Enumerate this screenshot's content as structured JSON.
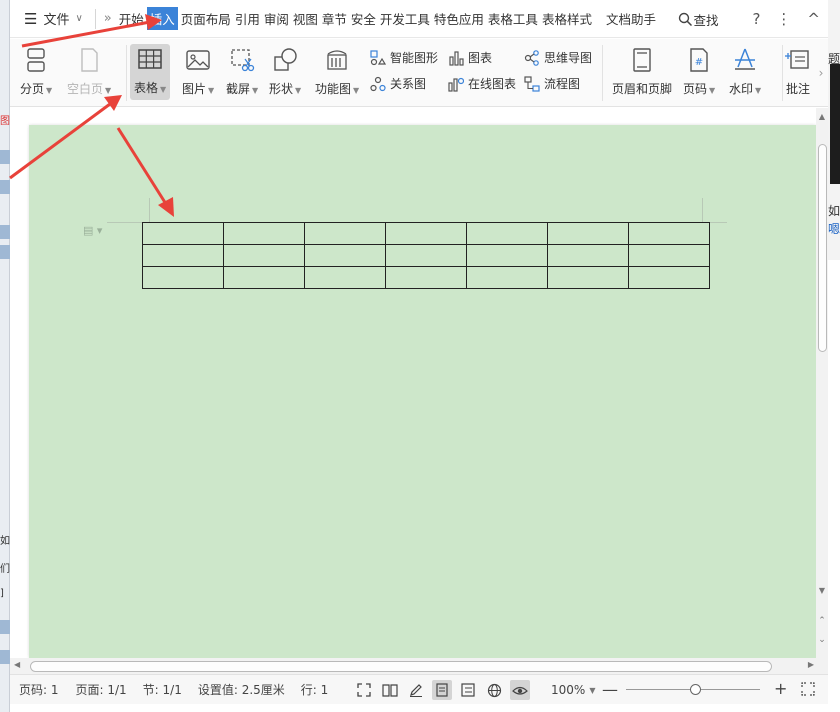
{
  "menubar": {
    "file_label": "文件",
    "tabs": [
      {
        "label": "开始"
      },
      {
        "label": "插入"
      },
      {
        "label": "页面布局"
      },
      {
        "label": "引用"
      },
      {
        "label": "审阅"
      },
      {
        "label": "视图"
      },
      {
        "label": "章节"
      },
      {
        "label": "安全"
      },
      {
        "label": "开发工具"
      },
      {
        "label": "特色应用"
      },
      {
        "label": "表格工具"
      },
      {
        "label": "表格样式"
      },
      {
        "label": "文档助手"
      }
    ],
    "active_tab": "插入",
    "find_label": "查找",
    "help": "?",
    "more": "⋮",
    "collapse": "^"
  },
  "ribbon": {
    "page_break": "分页",
    "blank_page": "空白页",
    "table": "表格",
    "picture": "图片",
    "screenshot": "截屏",
    "shapes": "形状",
    "function_chart": "功能图",
    "smart_graphic": "智能图形",
    "chart": "图表",
    "mind_map": "思维导图",
    "relation_chart": "关系图",
    "online_chart": "在线图表",
    "flowchart": "流程图",
    "header_footer": "页眉和页脚",
    "page_number": "页码",
    "watermark": "水印",
    "comment": "批注"
  },
  "document": {
    "table": {
      "rows": 3,
      "cols": 7
    }
  },
  "statusbar": {
    "page_code": "页码: 1",
    "page": "页面: 1/1",
    "section": "节: 1/1",
    "setting": "设置值: 2.5厘米",
    "line": "行: 1",
    "zoom": "100%",
    "zoom_level": 100
  },
  "background": {
    "left_fragments": [
      "图",
      "如",
      "们",
      "]"
    ],
    "right_fragments": [
      "题",
      "如",
      "嗯"
    ]
  },
  "colors": {
    "active_tab": "#3b83d8",
    "page_bg": "#cde7ca",
    "annotation_arrow": "#e8423a"
  }
}
